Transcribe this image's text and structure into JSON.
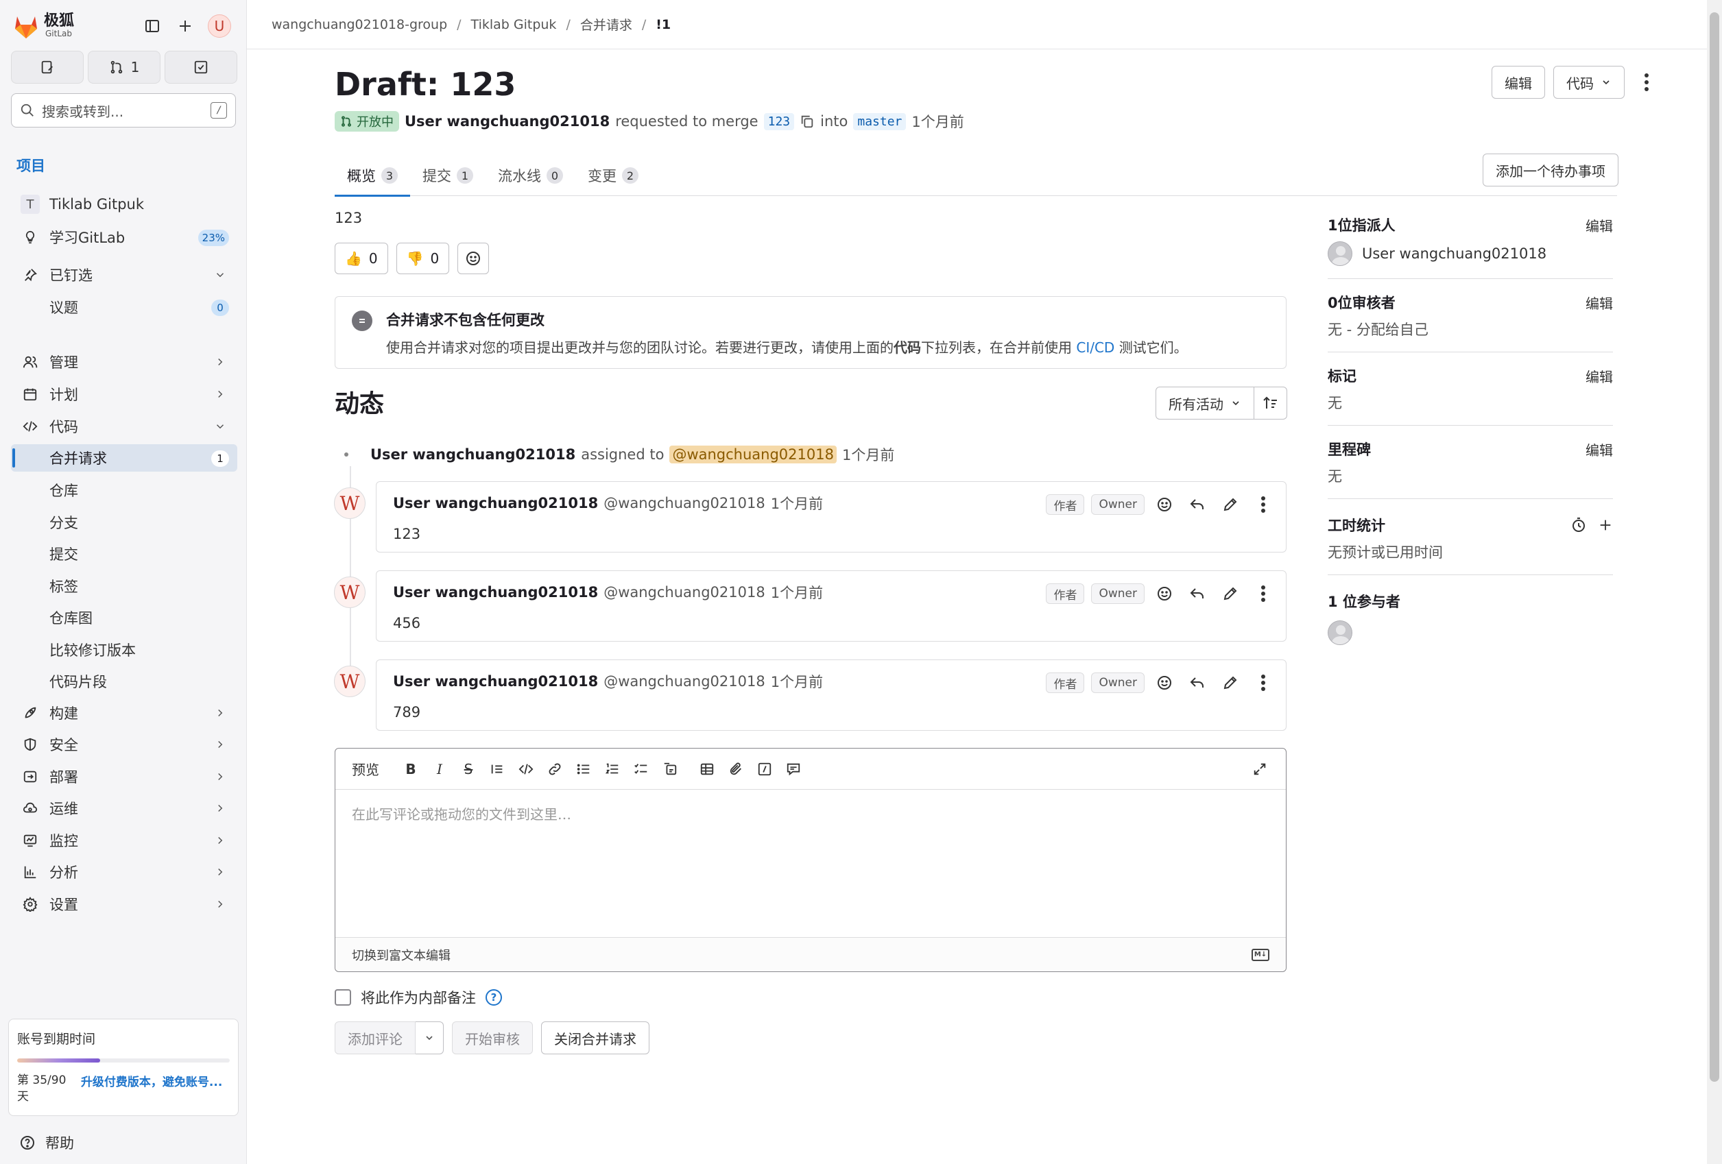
{
  "app": {
    "logo_text": "极狐",
    "logo_sub": "GitLab",
    "avatar_initial": "U",
    "merge_count": "1"
  },
  "sidebar": {
    "search_placeholder": "搜索或转到...",
    "search_shortcut": "/",
    "section_title": "项目",
    "project_initial": "T",
    "project_name": "Tiklab Gitpuk",
    "learn_label": "学习GitLab",
    "learn_progress": "23%",
    "pinned_label": "已钉选",
    "issues_label": "议题",
    "issues_count": "0",
    "items": {
      "manage": "管理",
      "plan": "计划",
      "code": "代码",
      "build": "构建",
      "secure": "安全",
      "deploy": "部署",
      "operate": "运维",
      "monitor": "监控",
      "analyze": "分析",
      "settings": "设置"
    },
    "code_sub": {
      "merge_requests": "合并请求",
      "merge_requests_count": "1",
      "repository": "仓库",
      "branches": "分支",
      "commits": "提交",
      "tags": "标签",
      "graph": "仓库图",
      "compare": "比较修订版本",
      "snippets": "代码片段"
    },
    "trial": {
      "title": "账号到期时间",
      "progress_fraction": 0.389,
      "day": "第 35/90 天",
      "upgrade": "升级付费版本，避免账号..."
    },
    "help": "帮助"
  },
  "breadcrumb": {
    "group": "wangchuang021018-group",
    "project": "Tiklab Gitpuk",
    "section": "合并请求",
    "current": "!1",
    "sep": "/"
  },
  "mr": {
    "title": "Draft: 123",
    "edit": "编辑",
    "code": "代码",
    "status": "开放中",
    "author": "User wangchuang021018",
    "requested": "requested to merge",
    "source_branch": "123",
    "into": "into",
    "target_branch": "master",
    "time": "1个月前",
    "todo": "添加一个待办事项",
    "description": "123",
    "thumbs_up": "0",
    "thumbs_down": "0"
  },
  "tabs": [
    {
      "label": "概览",
      "count": "3"
    },
    {
      "label": "提交",
      "count": "1"
    },
    {
      "label": "流水线",
      "count": "0"
    },
    {
      "label": "变更",
      "count": "2"
    }
  ],
  "notice": {
    "title": "合并请求不包含任何更改",
    "text_before": "使用合并请求对您的项目提出更改并与您的团队讨论。若要进行更改，请使用上面的",
    "text_bold": "代码",
    "text_mid": "下拉列表，在合并前使用",
    "text_link": "CI/CD",
    "text_after": "测试它们。"
  },
  "activity": {
    "title": "动态",
    "filter": "所有活动",
    "system_note": {
      "user": "User wangchuang021018",
      "action": "assigned to",
      "mention": "@wangchuang021018",
      "time": "1个月前"
    },
    "notes": [
      {
        "avatar": "W",
        "author": "User wangchuang021018",
        "username": "@wangchuang021018",
        "time": "1个月前",
        "badge1": "作者",
        "badge2": "Owner",
        "body": "123"
      },
      {
        "avatar": "W",
        "author": "User wangchuang021018",
        "username": "@wangchuang021018",
        "time": "1个月前",
        "badge1": "作者",
        "badge2": "Owner",
        "body": "456"
      },
      {
        "avatar": "W",
        "author": "User wangchuang021018",
        "username": "@wangchuang021018",
        "time": "1个月前",
        "badge1": "作者",
        "badge2": "Owner",
        "body": "789"
      }
    ]
  },
  "editor": {
    "preview": "预览",
    "placeholder": "在此写评论或拖动您的文件到这里…",
    "switch": "切换到富文本编辑",
    "md_badge": "M↓"
  },
  "internal_note": "将此作为内部备注",
  "buttons": {
    "add_comment": "添加评论",
    "start_review": "开始审核",
    "close_mr": "关闭合并请求"
  },
  "right": {
    "assignee_title": "1位指派人",
    "assignee_name": "User wangchuang021018",
    "reviewer_title": "0位审核者",
    "reviewer_value": "无 - 分配给自己",
    "labels_title": "标记",
    "labels_value": "无",
    "milestone_title": "里程碑",
    "milestone_value": "无",
    "time_title": "工时统计",
    "time_value": "无预计或已用时间",
    "participants_title": "1 位参与者",
    "edit": "编辑"
  }
}
